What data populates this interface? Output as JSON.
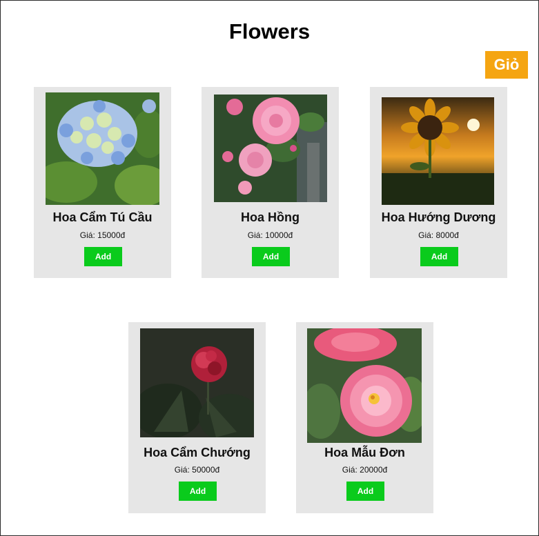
{
  "header": {
    "title": "Flowers",
    "cart_label": "Giỏ"
  },
  "products": [
    {
      "name": "Hoa Cẩm Tú Cầu",
      "price_label": "Giá:",
      "price": "15000đ",
      "button": "Add",
      "image": "hydrangea-photo"
    },
    {
      "name": "Hoa Hồng",
      "price_label": "Giá:",
      "price": "10000đ",
      "button": "Add",
      "image": "rose-photo"
    },
    {
      "name": "Hoa Hướng Dương",
      "price_label": "Giá:",
      "price": "8000đ",
      "button": "Add",
      "image": "sunflower-photo"
    },
    {
      "name": "Hoa Cẩm Chướng",
      "price_label": "Giá:",
      "price": "50000đ",
      "button": "Add",
      "image": "carnation-photo"
    },
    {
      "name": "Hoa Mẫu Đơn",
      "price_label": "Giá:",
      "price": "20000đ",
      "button": "Add",
      "image": "peony-photo"
    }
  ],
  "colors": {
    "cart_button": "#f5a512",
    "add_button": "#0acb1c",
    "card_bg": "#e6e6e6"
  }
}
